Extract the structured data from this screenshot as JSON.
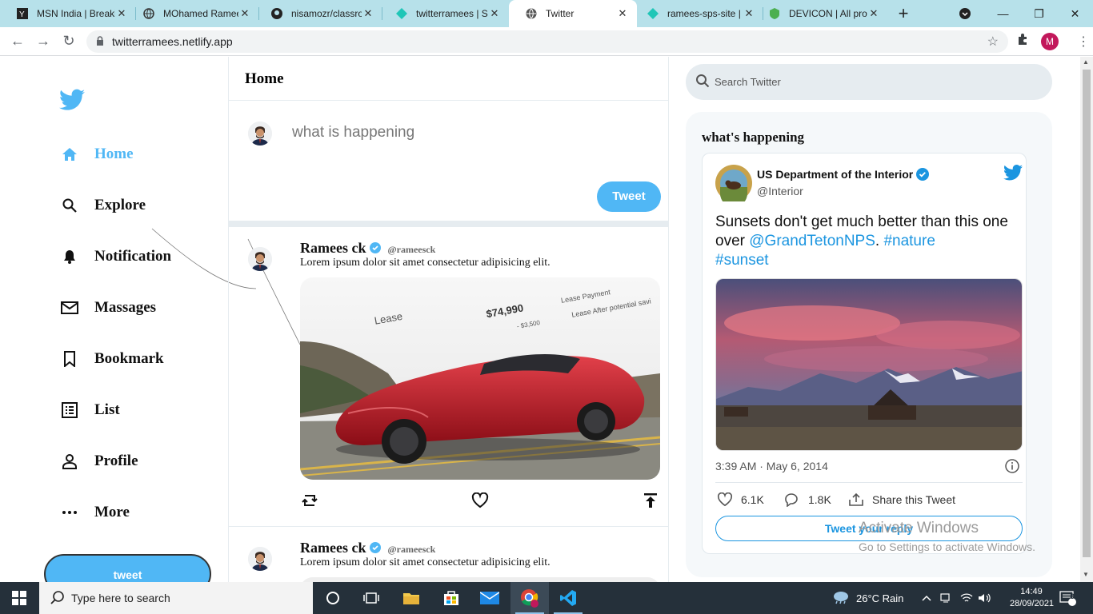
{
  "browser": {
    "tabs": [
      {
        "title": "MSN India | Breaki",
        "icon": "msn-icon"
      },
      {
        "title": "MOhamed Ramee",
        "icon": "globe-icon"
      },
      {
        "title": "nisamozr/classroo",
        "icon": "github-icon"
      },
      {
        "title": "twitterramees | Si",
        "icon": "netlify-icon"
      },
      {
        "title": "Twitter",
        "icon": "globe-icon"
      },
      {
        "title": "ramees-sps-site |",
        "icon": "netlify-icon"
      },
      {
        "title": "DEVICON | All pro",
        "icon": "devicon-icon"
      }
    ],
    "new_tab": "+",
    "address": "twitterramees.netlify.app",
    "profile_initial": "M"
  },
  "sidebar": {
    "items": [
      {
        "label": "Home",
        "icon": "home-icon"
      },
      {
        "label": "Explore",
        "icon": "search-icon"
      },
      {
        "label": "Notification",
        "icon": "bell-icon"
      },
      {
        "label": "Massages",
        "icon": "mail-icon"
      },
      {
        "label": "Bookmark",
        "icon": "bookmark-icon"
      },
      {
        "label": "List",
        "icon": "list-icon"
      },
      {
        "label": "Profile",
        "icon": "person-icon"
      },
      {
        "label": "More",
        "icon": "more-icon"
      }
    ],
    "tweet_button": "tweet"
  },
  "feed": {
    "title": "Home",
    "compose_placeholder": "what is happening",
    "compose_button": "Tweet",
    "posts": [
      {
        "name": "Ramees ck",
        "handle": "@rameesck",
        "text": "Lorem ipsum dolor sit amet consectetur adipisicing elit.",
        "image_text": {
          "lease": "Lease",
          "price": "$74,990",
          "payment": "Lease Payment",
          "after": "Lease After potential savi",
          "cash": "ash",
          "note": "- $3,500"
        }
      },
      {
        "name": "Ramees ck",
        "handle": "@rameesck",
        "text": "Lorem ipsum dolor sit amet consectetur adipisicing elit."
      }
    ]
  },
  "right": {
    "search_placeholder": "Search Twitter",
    "widget_title": "what's happening",
    "embed": {
      "name": "US Department of the Interior",
      "handle": "@Interior",
      "text_plain": "Sunsets don't get much better than this one over ",
      "mention": "@GrandTetonNPS",
      "text_mid": ". ",
      "hashtag1": "#nature",
      "hashtag2": "#sunset",
      "time": "3:39 AM · May 6, 2014",
      "likes": "6.1K",
      "replies": "1.8K",
      "share": "Share this Tweet",
      "reply_button": "Tweet your reply"
    }
  },
  "watermark": {
    "line1": "Activate Windows",
    "line2": "Go to Settings to activate Windows."
  },
  "taskbar": {
    "search_placeholder": "Type here to search",
    "weather": "26°C  Rain",
    "time": "14:49",
    "date": "28/09/2021",
    "notifications": "8"
  },
  "colors": {
    "twitter_blue": "#50b7f5",
    "link_blue": "#1b95e0",
    "tab_strip": "#b7e1ea",
    "taskbar": "#25303a"
  }
}
